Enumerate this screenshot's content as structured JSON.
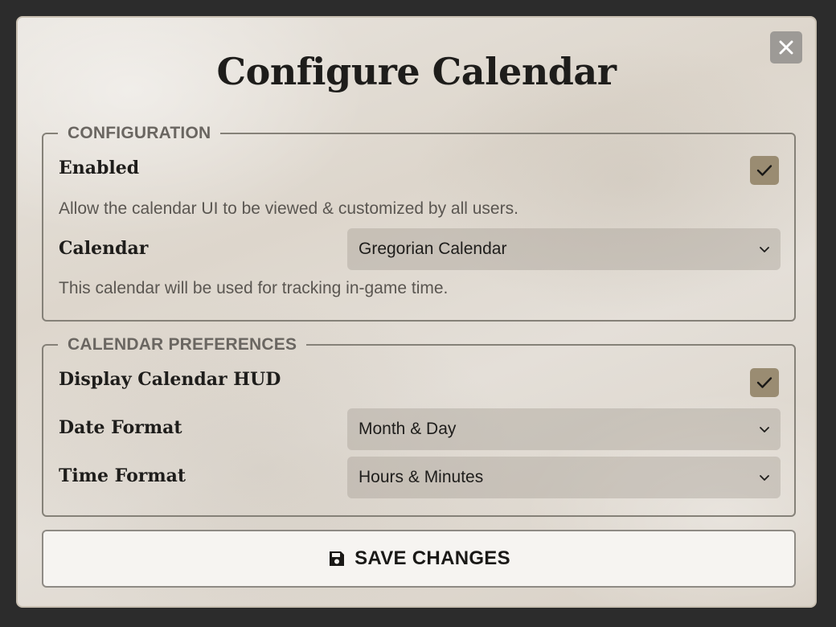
{
  "dialog": {
    "title": "Configure Calendar",
    "close_icon": "close-icon"
  },
  "configuration": {
    "legend": "CONFIGURATION",
    "enabled": {
      "label": "Enabled",
      "checked": true,
      "hint": "Allow the calendar UI to be viewed & customized by all users."
    },
    "calendar": {
      "label": "Calendar",
      "value": "Gregorian Calendar",
      "hint": "This calendar will be used for tracking in-game time."
    }
  },
  "preferences": {
    "legend": "CALENDAR PREFERENCES",
    "display_hud": {
      "label": "Display Calendar HUD",
      "checked": true
    },
    "date_format": {
      "label": "Date Format",
      "value": "Month & Day"
    },
    "time_format": {
      "label": "Time Format",
      "value": "Hours & Minutes"
    }
  },
  "footer": {
    "save_label": "SAVE CHANGES",
    "save_icon": "floppy-disk-icon"
  },
  "colors": {
    "checkbox_fill": "#9a8c72",
    "title_text": "#1e1d1b",
    "legend_text": "#6a6661",
    "select_fill": "#c9c2b8",
    "close_button": "#9d9a96"
  }
}
